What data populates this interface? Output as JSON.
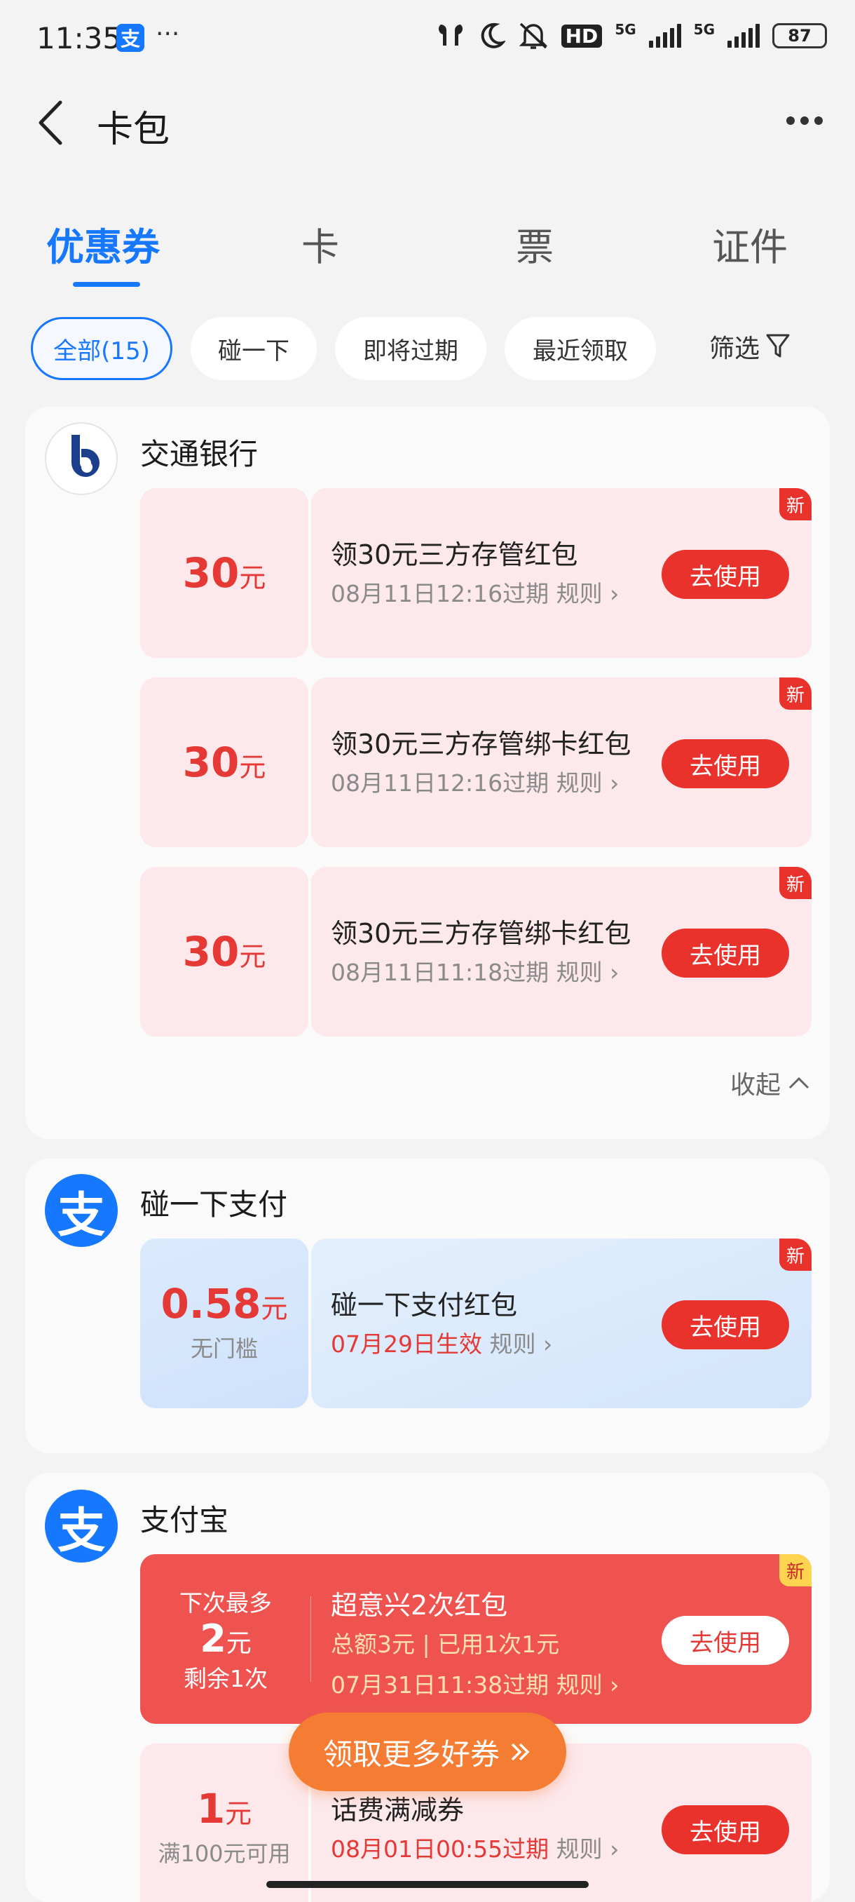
{
  "status_bar": {
    "time": "11:35",
    "app_icon_label": "支",
    "overflow": "···",
    "hd": "HD",
    "net1": "5G",
    "net2": "5G",
    "battery": "87"
  },
  "header": {
    "title": "卡包"
  },
  "tabs": [
    {
      "label": "优惠券",
      "active": true
    },
    {
      "label": "卡"
    },
    {
      "label": "票"
    },
    {
      "label": "证件"
    }
  ],
  "filters": {
    "all": "全部(15)",
    "touch": "碰一下",
    "expiring": "即将过期",
    "recent": "最近领取",
    "filter": "筛选"
  },
  "groups": [
    {
      "name": "交通银行",
      "coupons": [
        {
          "amount": "30",
          "unit": "元",
          "title": "领30元三方存管红包",
          "meta": "08月11日12:16过期",
          "rule": "规则",
          "button": "去使用",
          "badge": "新"
        },
        {
          "amount": "30",
          "unit": "元",
          "title": "领30元三方存管绑卡红包",
          "meta": "08月11日12:16过期",
          "rule": "规则",
          "button": "去使用",
          "badge": "新"
        },
        {
          "amount": "30",
          "unit": "元",
          "title": "领30元三方存管绑卡红包",
          "meta": "08月11日11:18过期",
          "rule": "规则",
          "button": "去使用",
          "badge": "新"
        }
      ],
      "collapse_label": "收起"
    },
    {
      "name": "碰一下支付",
      "logo_char": "支",
      "coupons": [
        {
          "amount": "0.58",
          "unit": "元",
          "sub": "无门槛",
          "title": "碰一下支付红包",
          "meta": "07月29日生效",
          "rule": "规则",
          "button": "去使用",
          "badge": "新"
        }
      ]
    },
    {
      "name": "支付宝",
      "logo_char": "支",
      "coupons": [
        {
          "top": "下次最多",
          "amount": "2",
          "unit": "元",
          "sub": "剩余1次",
          "title": "超意兴2次红包",
          "line2": "总额3元 | 已用1次1元",
          "meta": "07月31日11:38过期",
          "rule": "规则",
          "button": "去使用",
          "badge": "新"
        },
        {
          "amount": "1",
          "unit": "元",
          "sub": "满100元可用",
          "title": "话费满减券",
          "meta": "08月01日00:55过期",
          "rule": "规则",
          "button": "去使用"
        }
      ]
    }
  ],
  "floating_button": {
    "label": "领取更多好券"
  }
}
